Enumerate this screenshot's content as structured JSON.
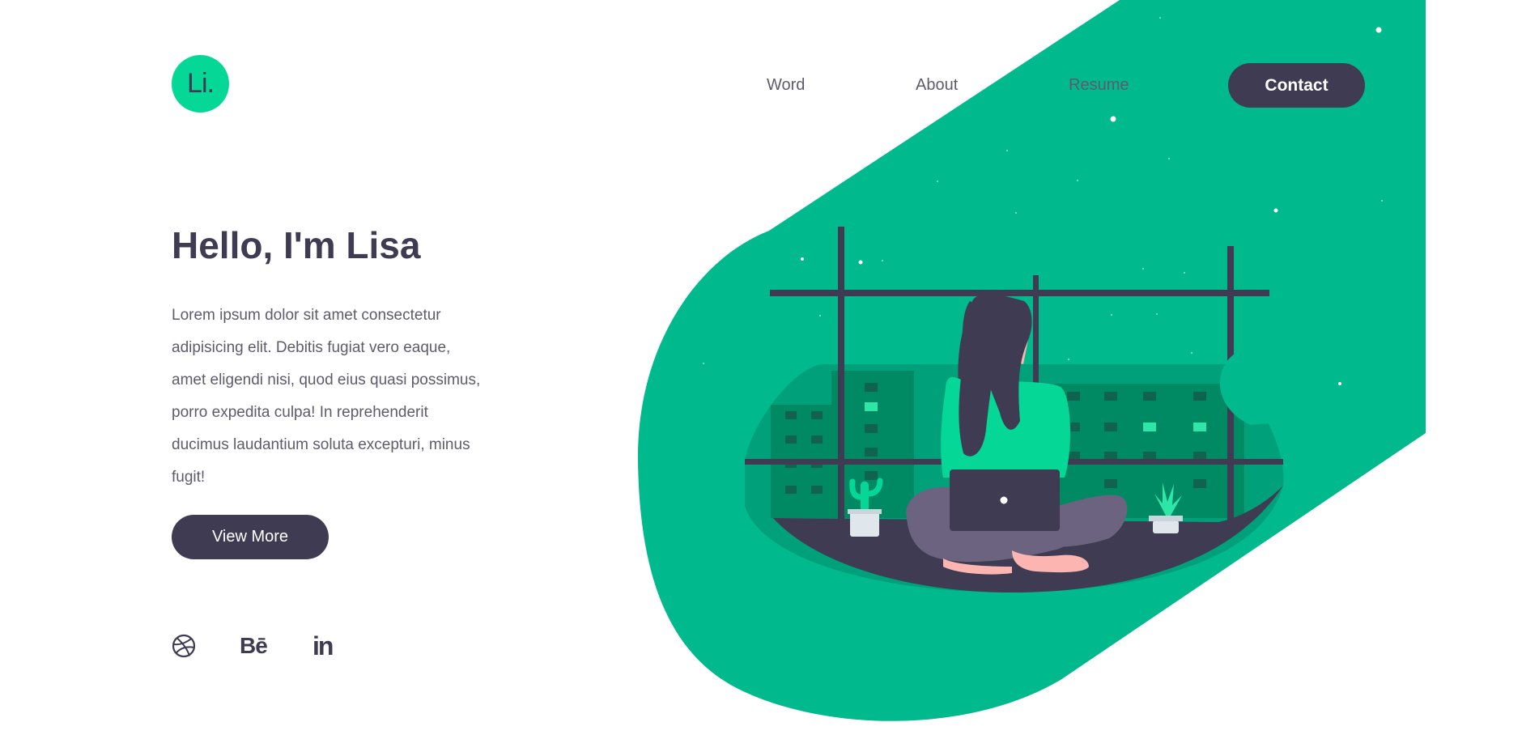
{
  "brand": {
    "logo_text": "Li."
  },
  "nav": {
    "items": [
      {
        "label": "Word"
      },
      {
        "label": "About"
      },
      {
        "label": "Resume"
      }
    ],
    "contact_label": "Contact"
  },
  "hero": {
    "title": "Hello, I'm Lisa",
    "text": "Lorem ipsum dolor sit amet consectetur adipisicing elit. Debitis fugiat vero eaque, amet eligendi nisi, quod eius quasi possimus, porro expedita culpa! In reprehenderit ducimus laudantium soluta excepturi, minus fugit!",
    "button_label": "View More"
  },
  "social": [
    {
      "icon": "dribbble-icon"
    },
    {
      "icon": "behance-icon",
      "text": "Bē"
    },
    {
      "icon": "linkedin-icon",
      "text": "in"
    }
  ],
  "colors": {
    "accent": "#05d896",
    "shape_green": "#00b98c",
    "dark": "#3e3b52",
    "text": "#5e5c6c",
    "skin": "#fcb5b0"
  }
}
